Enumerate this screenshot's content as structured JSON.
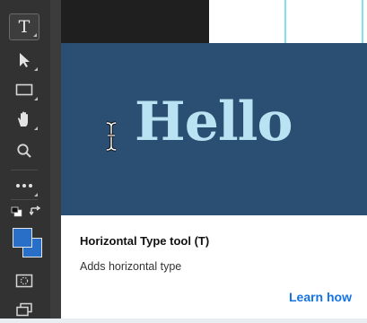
{
  "toolbar": {
    "tools": [
      {
        "name": "horizontal-type",
        "icon": "type-T-icon",
        "active": true
      },
      {
        "name": "move",
        "icon": "arrow-pointer-icon"
      },
      {
        "name": "marquee",
        "icon": "rectangle-marquee-icon"
      },
      {
        "name": "hand",
        "icon": "hand-icon"
      },
      {
        "name": "zoom",
        "icon": "magnifier-icon"
      },
      {
        "name": "more",
        "icon": "ellipsis-icon"
      }
    ],
    "foreground_color": "#2a6fc7",
    "background_color": "#2a6fc7"
  },
  "tooltip": {
    "preview_text": "Hello",
    "preview_background": "#2b4f73",
    "preview_text_color": "#b9e3f2",
    "title": "Horizontal Type tool (T)",
    "description": "Adds horizontal type",
    "link_label": "Learn how",
    "link_color": "#1473e6"
  },
  "tool_glyphs": {
    "type": "T"
  }
}
